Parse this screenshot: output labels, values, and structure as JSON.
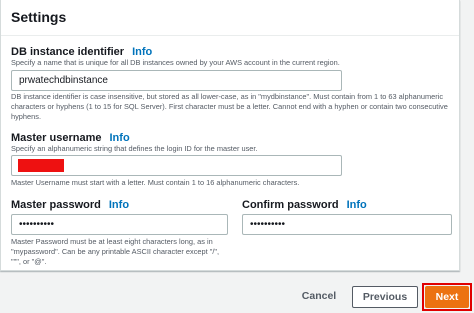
{
  "settings": {
    "title": "Settings",
    "db_identifier": {
      "label": "DB instance identifier",
      "info": "Info",
      "description": "Specify a name that is unique for all DB instances owned by your AWS account in the current region.",
      "value": "prwatechdbinstance",
      "hint": "DB instance identifier is case insensitive, but stored as all lower-case, as in \"mydbinstance\". Must contain from 1 to 63 alphanumeric characters or hyphens (1 to 15 for SQL Server). First character must be a letter. Cannot end with a hyphen or contain two consecutive hyphens."
    },
    "master_username": {
      "label": "Master username",
      "info": "Info",
      "description": "Specify an alphanumeric string that defines the login ID for the master user.",
      "value": "",
      "hint": "Master Username must start with a letter. Must contain 1 to 16 alphanumeric characters."
    },
    "master_password": {
      "label": "Master password",
      "info": "Info",
      "value": "••••••••••",
      "hint": "Master Password must be at least eight characters long, as in \"mypassword\". Can be any printable ASCII character except \"/\", \"\"\", or \"@\"."
    },
    "confirm_password": {
      "label": "Confirm password",
      "info": "Info",
      "value": "••••••••••"
    }
  },
  "footer": {
    "cancel_label": "Cancel",
    "previous_label": "Previous",
    "next_label": "Next"
  },
  "colors": {
    "accent": "#ec7211",
    "link": "#0073bb",
    "highlight": "#e00000",
    "redaction": "#ee1111"
  }
}
